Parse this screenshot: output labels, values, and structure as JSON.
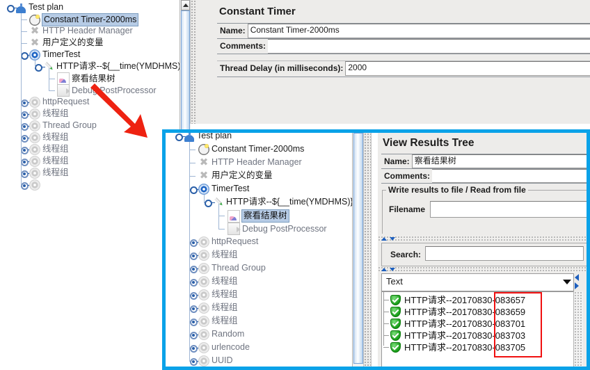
{
  "app": {
    "selection_color": "#b6cbe5",
    "inset_border_color": "#0aa2e8",
    "highlight_box_color": "#f01010",
    "arrow_color": "#ee2211"
  },
  "main_tree": {
    "name": "test-plan-tree",
    "nodes": [
      {
        "label": "Test plan",
        "icon": "flask-icon",
        "indent": 0,
        "dim": false,
        "selected": false,
        "handle": "expanded"
      },
      {
        "label": "Constant Timer-2000ms",
        "icon": "clock-icon",
        "indent": 1,
        "dim": false,
        "selected": true,
        "handle": "none"
      },
      {
        "label": "HTTP Header Manager",
        "icon": "x-icon",
        "indent": 1,
        "dim": true,
        "selected": false,
        "handle": "none"
      },
      {
        "label": "用户定义的变量",
        "icon": "x-icon",
        "indent": 1,
        "dim": false,
        "selected": false,
        "handle": "none"
      },
      {
        "label": "TimerTest",
        "icon": "gear-blue-icon",
        "indent": 1,
        "dim": false,
        "selected": false,
        "handle": "expanded"
      },
      {
        "label": "HTTP请求--${__time(YMDHMS)}",
        "icon": "pen-icon",
        "indent": 2,
        "dim": false,
        "selected": false,
        "handle": "expanded"
      },
      {
        "label": "察看结果树",
        "icon": "chart-icon",
        "indent": 3,
        "dim": false,
        "selected": false,
        "handle": "none"
      },
      {
        "label": "Debug PostProcessor",
        "icon": "document-icon",
        "indent": 3,
        "dim": true,
        "selected": false,
        "handle": "none"
      },
      {
        "label": "httpRequest",
        "icon": "gear-faint-icon",
        "indent": 1,
        "dim": true,
        "selected": false,
        "handle": "collapsed"
      },
      {
        "label": "线程组",
        "icon": "gear-faint-icon",
        "indent": 1,
        "dim": true,
        "selected": false,
        "handle": "collapsed"
      },
      {
        "label": "Thread Group",
        "icon": "gear-faint-icon",
        "indent": 1,
        "dim": true,
        "selected": false,
        "handle": "collapsed"
      },
      {
        "label": "线程组",
        "icon": "gear-faint-icon",
        "indent": 1,
        "dim": true,
        "selected": false,
        "handle": "collapsed"
      },
      {
        "label": "线程组",
        "icon": "gear-faint-icon",
        "indent": 1,
        "dim": true,
        "selected": false,
        "handle": "collapsed"
      },
      {
        "label": "线程组",
        "icon": "gear-faint-icon",
        "indent": 1,
        "dim": true,
        "selected": false,
        "handle": "collapsed"
      },
      {
        "label": "线程组",
        "icon": "gear-faint-icon",
        "indent": 1,
        "dim": true,
        "selected": false,
        "handle": "collapsed"
      },
      {
        "label": "",
        "icon": "gear-faint-icon",
        "indent": 1,
        "dim": true,
        "selected": false,
        "handle": "collapsed"
      }
    ]
  },
  "constant_timer_panel": {
    "title": "Constant Timer",
    "name_label": "Name:",
    "name_value": "Constant Timer-2000ms",
    "comments_label": "Comments:",
    "comments_value": "",
    "delay_label": "Thread Delay (in milliseconds):",
    "delay_value": "2000"
  },
  "inset": {
    "tree": {
      "name": "test-plan-tree-zoomed",
      "nodes": [
        {
          "label": "Test plan",
          "icon": "flask-icon",
          "indent": 0,
          "dim": false,
          "selected": false,
          "handle": "expanded"
        },
        {
          "label": "Constant Timer-2000ms",
          "icon": "clock-icon",
          "indent": 1,
          "dim": false,
          "selected": false,
          "handle": "none"
        },
        {
          "label": "HTTP Header Manager",
          "icon": "x-icon",
          "indent": 1,
          "dim": true,
          "selected": false,
          "handle": "none"
        },
        {
          "label": "用户定义的变量",
          "icon": "x-icon",
          "indent": 1,
          "dim": false,
          "selected": false,
          "handle": "none"
        },
        {
          "label": "TimerTest",
          "icon": "gear-blue-icon",
          "indent": 1,
          "dim": false,
          "selected": false,
          "handle": "expanded"
        },
        {
          "label": "HTTP请求--${__time(YMDHMS)}",
          "icon": "pen-icon",
          "indent": 2,
          "dim": false,
          "selected": false,
          "handle": "expanded"
        },
        {
          "label": "察看结果树",
          "icon": "chart-icon",
          "indent": 3,
          "dim": false,
          "selected": true,
          "handle": "none"
        },
        {
          "label": "Debug PostProcessor",
          "icon": "document-icon",
          "indent": 3,
          "dim": true,
          "selected": false,
          "handle": "none"
        },
        {
          "label": "httpRequest",
          "icon": "gear-faint-icon",
          "indent": 1,
          "dim": true,
          "selected": false,
          "handle": "collapsed"
        },
        {
          "label": "线程组",
          "icon": "gear-faint-icon",
          "indent": 1,
          "dim": true,
          "selected": false,
          "handle": "collapsed"
        },
        {
          "label": "Thread Group",
          "icon": "gear-faint-icon",
          "indent": 1,
          "dim": true,
          "selected": false,
          "handle": "collapsed"
        },
        {
          "label": "线程组",
          "icon": "gear-faint-icon",
          "indent": 1,
          "dim": true,
          "selected": false,
          "handle": "collapsed"
        },
        {
          "label": "线程组",
          "icon": "gear-faint-icon",
          "indent": 1,
          "dim": true,
          "selected": false,
          "handle": "collapsed"
        },
        {
          "label": "线程组",
          "icon": "gear-faint-icon",
          "indent": 1,
          "dim": true,
          "selected": false,
          "handle": "collapsed"
        },
        {
          "label": "线程组",
          "icon": "gear-faint-icon",
          "indent": 1,
          "dim": true,
          "selected": false,
          "handle": "collapsed"
        },
        {
          "label": "Random",
          "icon": "gear-faint-icon",
          "indent": 1,
          "dim": true,
          "selected": false,
          "handle": "collapsed"
        },
        {
          "label": "urlencode",
          "icon": "gear-faint-icon",
          "indent": 1,
          "dim": true,
          "selected": false,
          "handle": "collapsed"
        },
        {
          "label": "UUID",
          "icon": "gear-faint-icon",
          "indent": 1,
          "dim": true,
          "selected": false,
          "handle": "collapsed"
        }
      ]
    },
    "results_panel": {
      "title": "View Results Tree",
      "name_label": "Name:",
      "name_value": "察看结果树",
      "comments_label": "Comments:",
      "comments_value": "",
      "file_group_label": "Write results to file / Read from file",
      "filename_label": "Filename",
      "filename_value": "",
      "search_label": "Search:",
      "search_value": "",
      "search_placeholder": "",
      "view_selector_value": "Text",
      "results": [
        {
          "status": "success",
          "label": "HTTP请求--20170830-083657",
          "prefix": "HTTP请求--20170830-",
          "suffix": "083657"
        },
        {
          "status": "success",
          "label": "HTTP请求--20170830-083659",
          "prefix": "HTTP请求--20170830-",
          "suffix": "083659"
        },
        {
          "status": "success",
          "label": "HTTP请求--20170830-083701",
          "prefix": "HTTP请求--20170830-",
          "suffix": "083701"
        },
        {
          "status": "success",
          "label": "HTTP请求--20170830-083703",
          "prefix": "HTTP请求--20170830-",
          "suffix": "083703"
        },
        {
          "status": "success",
          "label": "HTTP请求--20170830-083705",
          "prefix": "HTTP请求--20170830-",
          "suffix": "083705"
        }
      ]
    }
  }
}
